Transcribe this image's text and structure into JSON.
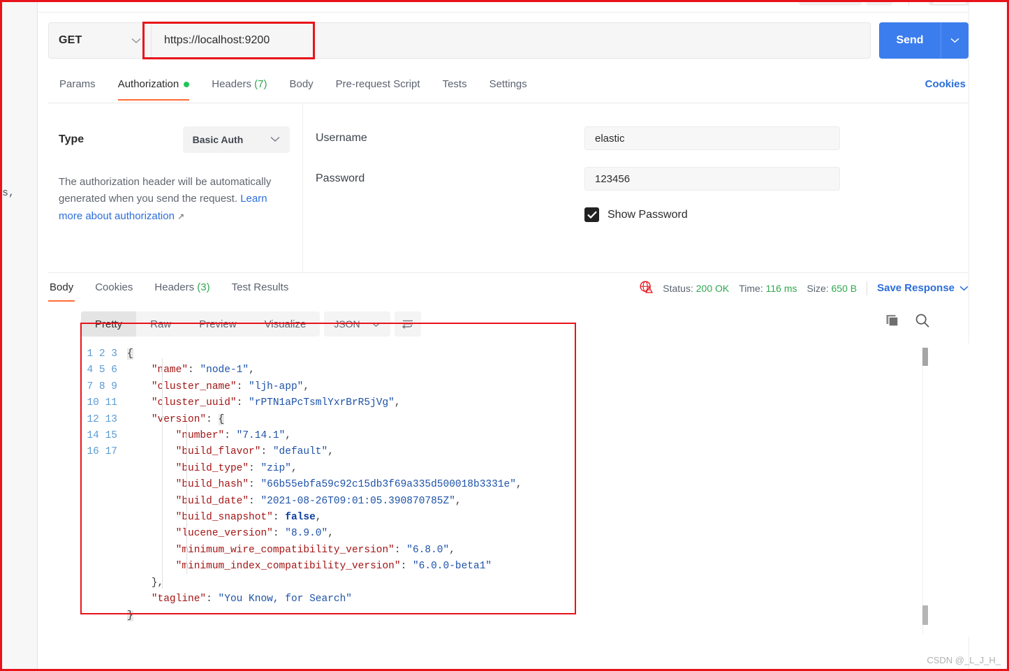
{
  "request": {
    "method": "GET",
    "url": "https://localhost:9200",
    "send_label": "Send",
    "tabs": [
      {
        "label": "Params",
        "active": false,
        "dot": false,
        "count": ""
      },
      {
        "label": "Authorization",
        "active": true,
        "dot": true,
        "count": ""
      },
      {
        "label": "Headers",
        "active": false,
        "dot": false,
        "count": "(7)"
      },
      {
        "label": "Body",
        "active": false,
        "dot": false,
        "count": ""
      },
      {
        "label": "Pre-request Script",
        "active": false,
        "dot": false,
        "count": ""
      },
      {
        "label": "Tests",
        "active": false,
        "dot": false,
        "count": ""
      },
      {
        "label": "Settings",
        "active": false,
        "dot": false,
        "count": ""
      }
    ],
    "cookies_link": "Cookies"
  },
  "auth": {
    "type_label": "Type",
    "type_value": "Basic Auth",
    "description_prefix": "The authorization header will be automatically generated when you send the request. ",
    "description_link": "Learn more about authorization",
    "link_arrow": "↗",
    "username_label": "Username",
    "username_value": "elastic",
    "username_placeholder": "Username",
    "password_label": "Password",
    "password_value": "123456",
    "password_placeholder": "Password",
    "show_password_label": "Show Password",
    "show_password_checked": true
  },
  "response": {
    "tabs": [
      {
        "label": "Body",
        "active": true,
        "count": ""
      },
      {
        "label": "Cookies",
        "active": false,
        "count": ""
      },
      {
        "label": "Headers",
        "active": false,
        "count": "(3)"
      },
      {
        "label": "Test Results",
        "active": false,
        "count": ""
      }
    ],
    "status_label": "Status:",
    "status_value": "200 OK",
    "time_label": "Time:",
    "time_value": "116 ms",
    "size_label": "Size:",
    "size_value": "650 B",
    "save_response": "Save Response",
    "format_tabs": [
      {
        "label": "Pretty",
        "active": true
      },
      {
        "label": "Raw",
        "active": false
      },
      {
        "label": "Preview",
        "active": false
      },
      {
        "label": "Visualize",
        "active": false
      }
    ],
    "format_type": "JSON",
    "body_lines": [
      {
        "n": "1",
        "indent": 0,
        "tokens": [
          {
            "t": "{",
            "c": "brace"
          }
        ]
      },
      {
        "n": "2",
        "indent": 1,
        "tokens": [
          {
            "t": "\"name\"",
            "c": "k"
          },
          {
            "t": ": ",
            "c": "p"
          },
          {
            "t": "\"node-1\"",
            "c": "s"
          },
          {
            "t": ",",
            "c": "p"
          }
        ]
      },
      {
        "n": "3",
        "indent": 1,
        "tokens": [
          {
            "t": "\"cluster_name\"",
            "c": "k"
          },
          {
            "t": ": ",
            "c": "p"
          },
          {
            "t": "\"ljh-app\"",
            "c": "s"
          },
          {
            "t": ",",
            "c": "p"
          }
        ]
      },
      {
        "n": "4",
        "indent": 1,
        "tokens": [
          {
            "t": "\"cluster_uuid\"",
            "c": "k"
          },
          {
            "t": ": ",
            "c": "p"
          },
          {
            "t": "\"rPTN1aPcTsmlYxrBrR5jVg\"",
            "c": "s"
          },
          {
            "t": ",",
            "c": "p"
          }
        ]
      },
      {
        "n": "5",
        "indent": 1,
        "tokens": [
          {
            "t": "\"version\"",
            "c": "k"
          },
          {
            "t": ": ",
            "c": "p"
          },
          {
            "t": "{",
            "c": "brace"
          }
        ]
      },
      {
        "n": "6",
        "indent": 2,
        "tokens": [
          {
            "t": "\"number\"",
            "c": "k"
          },
          {
            "t": ": ",
            "c": "p"
          },
          {
            "t": "\"7.14.1\"",
            "c": "s"
          },
          {
            "t": ",",
            "c": "p"
          }
        ]
      },
      {
        "n": "7",
        "indent": 2,
        "tokens": [
          {
            "t": "\"build_flavor\"",
            "c": "k"
          },
          {
            "t": ": ",
            "c": "p"
          },
          {
            "t": "\"default\"",
            "c": "s"
          },
          {
            "t": ",",
            "c": "p"
          }
        ]
      },
      {
        "n": "8",
        "indent": 2,
        "tokens": [
          {
            "t": "\"build_type\"",
            "c": "k"
          },
          {
            "t": ": ",
            "c": "p"
          },
          {
            "t": "\"zip\"",
            "c": "s"
          },
          {
            "t": ",",
            "c": "p"
          }
        ]
      },
      {
        "n": "9",
        "indent": 2,
        "tokens": [
          {
            "t": "\"build_hash\"",
            "c": "k"
          },
          {
            "t": ": ",
            "c": "p"
          },
          {
            "t": "\"66b55ebfa59c92c15db3f69a335d500018b3331e\"",
            "c": "s"
          },
          {
            "t": ",",
            "c": "p"
          }
        ]
      },
      {
        "n": "10",
        "indent": 2,
        "tokens": [
          {
            "t": "\"build_date\"",
            "c": "k"
          },
          {
            "t": ": ",
            "c": "p"
          },
          {
            "t": "\"2021-08-26T09:01:05.390870785Z\"",
            "c": "s"
          },
          {
            "t": ",",
            "c": "p"
          }
        ]
      },
      {
        "n": "11",
        "indent": 2,
        "tokens": [
          {
            "t": "\"build_snapshot\"",
            "c": "k"
          },
          {
            "t": ": ",
            "c": "p"
          },
          {
            "t": "false",
            "c": "b"
          },
          {
            "t": ",",
            "c": "p"
          }
        ]
      },
      {
        "n": "12",
        "indent": 2,
        "tokens": [
          {
            "t": "\"lucene_version\"",
            "c": "k"
          },
          {
            "t": ": ",
            "c": "p"
          },
          {
            "t": "\"8.9.0\"",
            "c": "s"
          },
          {
            "t": ",",
            "c": "p"
          }
        ]
      },
      {
        "n": "13",
        "indent": 2,
        "tokens": [
          {
            "t": "\"minimum_wire_compatibility_version\"",
            "c": "k"
          },
          {
            "t": ": ",
            "c": "p"
          },
          {
            "t": "\"6.8.0\"",
            "c": "s"
          },
          {
            "t": ",",
            "c": "p"
          }
        ]
      },
      {
        "n": "14",
        "indent": 2,
        "tokens": [
          {
            "t": "\"minimum_index_compatibility_version\"",
            "c": "k"
          },
          {
            "t": ": ",
            "c": "p"
          },
          {
            "t": "\"6.0.0-beta1\"",
            "c": "s"
          }
        ]
      },
      {
        "n": "15",
        "indent": 1,
        "tokens": [
          {
            "t": "}",
            "c": "p"
          },
          {
            "t": ",",
            "c": "p"
          }
        ]
      },
      {
        "n": "16",
        "indent": 1,
        "tokens": [
          {
            "t": "\"tagline\"",
            "c": "k"
          },
          {
            "t": ": ",
            "c": "p"
          },
          {
            "t": "\"You Know, for Search\"",
            "c": "s"
          }
        ]
      },
      {
        "n": "17",
        "indent": 0,
        "tokens": [
          {
            "t": "}",
            "c": "brace"
          }
        ]
      }
    ]
  },
  "misc": {
    "left_edge_text": "s,",
    "watermark": "CSDN @_L_J_H_"
  },
  "colors": {
    "accent_orange": "#ff6c37",
    "link_blue": "#2b6ed9",
    "send_blue": "#3b7ded",
    "status_green": "#2fa84f",
    "annotation_red": "#e8131a"
  }
}
